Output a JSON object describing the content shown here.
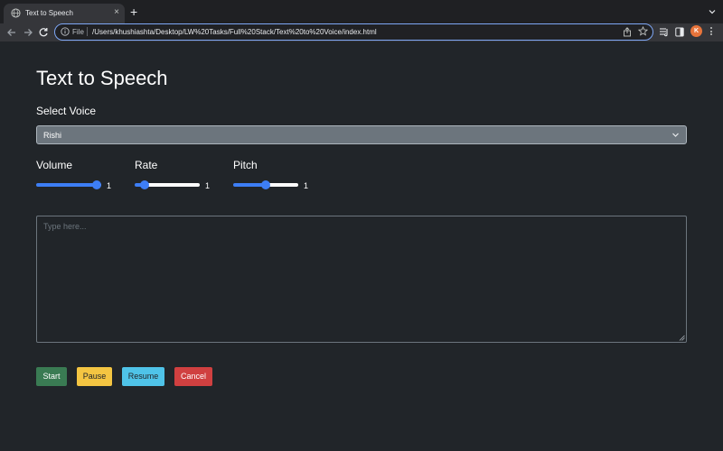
{
  "browser": {
    "tab_title": "Text to Speech",
    "tab_close": "×",
    "new_tab": "+",
    "scheme_label": "File",
    "url": "/Users/khushiashta/Desktop/LW%20Tasks/Full%20Stack/Text%20to%20Voice/index.html",
    "profile_initial": "K",
    "icons": [
      "globe-icon",
      "back-arrow-icon",
      "forward-arrow-icon",
      "reload-icon",
      "info-icon",
      "share-icon",
      "star-icon",
      "reading-list-icon",
      "side-panel-icon",
      "kebab-menu-icon",
      "chevron-down-icon"
    ],
    "accent": "#7ea7f5",
    "profile_color": "#e8743b"
  },
  "page": {
    "title": "Text to Speech",
    "select_voice_label": "Select Voice",
    "voice_selected": "Rishi",
    "volume_label": "Volume",
    "volume_value": "1",
    "volume_level": 1.0,
    "rate_label": "Rate",
    "rate_value": "1",
    "rate_level": 0.1,
    "pitch_label": "Pitch",
    "pitch_value": "1",
    "pitch_level": 0.5,
    "textarea_placeholder": "Type here...",
    "buttons": {
      "start": "Start",
      "pause": "Pause",
      "resume": "Resume",
      "cancel": "Cancel"
    },
    "colors": {
      "background": "#212529",
      "select_bg": "#6c757d",
      "slider_accent": "#3d7ef5",
      "start": "#3a7b53",
      "pause": "#f4c542",
      "resume": "#4fc3e8",
      "cancel": "#d04040"
    }
  }
}
